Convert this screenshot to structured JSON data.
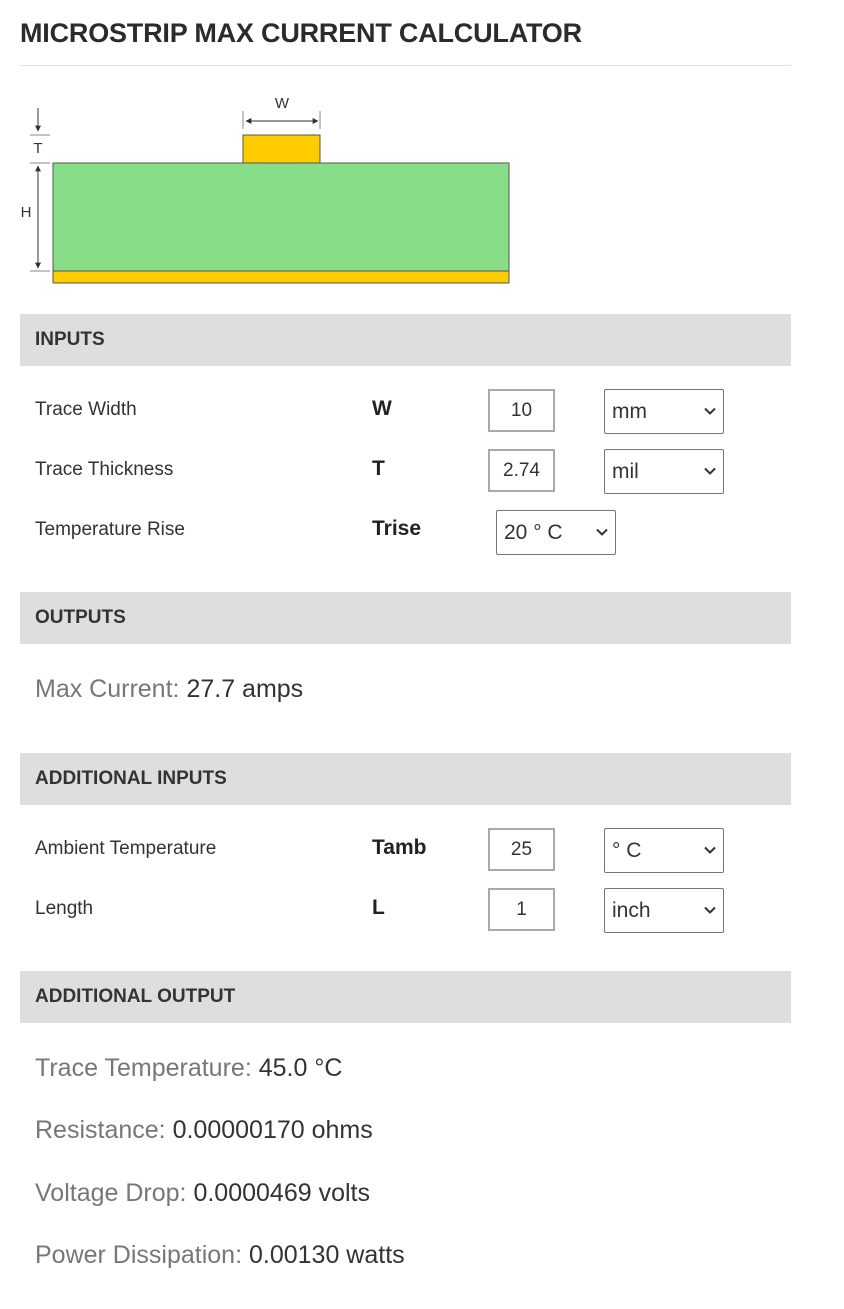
{
  "title": "MICROSTRIP MAX CURRENT CALCULATOR",
  "diagram": {
    "width_label": "W",
    "thickness_label": "T",
    "height_label": "H",
    "colors": {
      "substrate": "#88de88",
      "copper": "#ffcc00",
      "outline": "#555555"
    }
  },
  "inputs": {
    "header": "INPUTS",
    "trace_width": {
      "label": "Trace Width",
      "symbol": "W",
      "value": "10",
      "unit": "mm"
    },
    "trace_thickness": {
      "label": "Trace Thickness",
      "symbol": "T",
      "value": "2.74",
      "unit": "mil"
    },
    "temperature_rise": {
      "label": "Temperature Rise",
      "symbol": "Trise",
      "unit": "20 ° C"
    }
  },
  "outputs": {
    "header": "OUTPUTS",
    "max_current": {
      "label": "Max Current:",
      "value": "27.7 amps"
    }
  },
  "additional_inputs": {
    "header": "ADDITIONAL INPUTS",
    "ambient_temperature": {
      "label": "Ambient Temperature",
      "symbol": "Tamb",
      "value": "25",
      "unit": "° C"
    },
    "length": {
      "label": "Length",
      "symbol": "L",
      "value": "1",
      "unit": "inch"
    }
  },
  "additional_output": {
    "header": "ADDITIONAL OUTPUT",
    "trace_temperature": {
      "label": "Trace Temperature:",
      "value": "45.0 °C"
    },
    "resistance": {
      "label": "Resistance:",
      "value": "0.00000170 ohms"
    },
    "voltage_drop": {
      "label": "Voltage Drop:",
      "value": "0.0000469 volts"
    },
    "power_dissipation": {
      "label": "Power Dissipation:",
      "value": "0.00130 watts"
    }
  }
}
